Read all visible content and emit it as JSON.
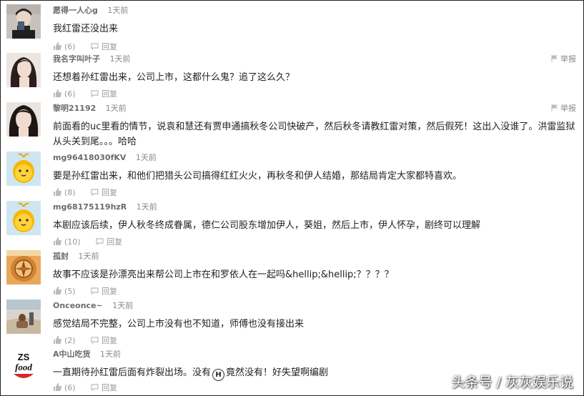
{
  "comments": [
    {
      "user": "愿得一人心g",
      "time": "1天前",
      "text": "我红雷还没出来",
      "likes": "(6)",
      "reply": "回复",
      "report": ""
    },
    {
      "user": "我名字叫叶子",
      "time": "1天前",
      "text": "还想着孙红雷出来，公司上市，这都什么鬼？追了这么久？",
      "likes": "(6)",
      "reply": "回复",
      "report": "举报"
    },
    {
      "user": "黎明21192",
      "time": "1天前",
      "text": "前面看的uc里看的情节，说袁和慧还有贾申通搞秋冬公司快破产，然后秋冬请教红雷对策，然后假死！这出入没谁了。洪雷监狱从头关到尾。。。哈哈",
      "likes": "",
      "reply": "",
      "report": "举报"
    },
    {
      "user": "mg96418030fKV",
      "time": "1天前",
      "text": "要是孙红雷出来，和他们把猎头公司搞得红红火火，再秋冬和伊人结婚，那结局肯定大家都特喜欢。",
      "likes": "(8)",
      "reply": "回复",
      "report": ""
    },
    {
      "user": "mg68175119hzR",
      "time": "1天前",
      "text": "本剧应该后续，伊人秋冬终成眷属，德仁公司股东增加伊人，葵姐，然后上市，伊人怀孕，剧终可以理解",
      "likes": "(10)",
      "reply": "回复",
      "report": ""
    },
    {
      "user": "孤封",
      "time": "1天前",
      "text": "故事不应该是孙漂亮出来帮公司上市在和罗依人在一起吗&hellip;&hellip;？？？？",
      "likes": "(5)",
      "reply": "回复",
      "report": ""
    },
    {
      "user": "Onceonce~",
      "time": "1天前",
      "text": "感觉结局不完整，公司上市没有也不知道，师傅也没有接出来",
      "likes": "(2)",
      "reply": "回复",
      "report": ""
    },
    {
      "user": "A中山吃货",
      "time": "1天前",
      "text_a": "一直期待孙红雷后面有炸裂出场。没有",
      "emoji": "H",
      "text_b": "竟然没有！好失望啊编剧",
      "likes": "(6)",
      "reply": "回复",
      "report": ""
    }
  ],
  "avatar_logo": {
    "line1": "ZS",
    "line2": "food"
  },
  "watermark": "头条号 / 灰灰娱乐说",
  "icons": {
    "like": "thumbs-up-icon",
    "reply": "speech-bubble-icon",
    "report": "flag-icon"
  },
  "colors": {
    "text": "#222222",
    "meta": "#888888",
    "action": "#999999"
  }
}
